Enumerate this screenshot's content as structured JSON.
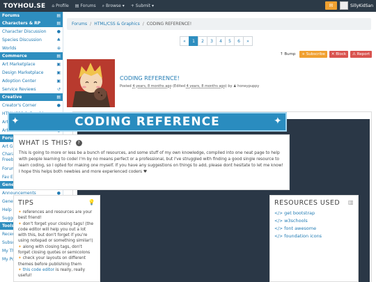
{
  "navbar": {
    "brand": "TOYHOU.SE",
    "links": [
      {
        "icon": "home-icon",
        "glyph": "⌂",
        "label": "Profile"
      },
      {
        "icon": "forums-icon",
        "glyph": "▤",
        "label": "Forums"
      },
      {
        "icon": "search-icon",
        "glyph": "⌕",
        "label": "Browse ▾"
      },
      {
        "icon": "plus-icon",
        "glyph": "+",
        "label": "Submit ▾"
      }
    ],
    "mail_glyph": "✉",
    "username": "SillyKidSan"
  },
  "sidebar": {
    "sections": [
      {
        "title": "Forums",
        "items": []
      },
      {
        "title": "Characters & RP",
        "items": [
          {
            "label": "Character Discussion",
            "glyph": "●"
          },
          {
            "label": "Species Discussion",
            "glyph": "♣"
          },
          {
            "label": "Worlds",
            "glyph": "⊕"
          }
        ]
      },
      {
        "title": "Commerce",
        "items": [
          {
            "label": "Art Marketplace",
            "glyph": "▣"
          },
          {
            "label": "Design Marketplace",
            "glyph": "▣"
          },
          {
            "label": "Adoption Center",
            "glyph": "▣"
          },
          {
            "label": "Service Reviews",
            "glyph": "↺"
          }
        ]
      },
      {
        "title": "Creative",
        "items": [
          {
            "label": "Creator's Corner",
            "glyph": "●"
          },
          {
            "label": "HTML/CSS & Graphics",
            "glyph": "‹›"
          },
          {
            "label": "Art Freebies",
            "glyph": "●"
          },
          {
            "label": "Art Trades",
            "glyph": "●"
          }
        ]
      },
      {
        "title": "Forum Games",
        "items": [
          {
            "label": "Art Games",
            "glyph": "●"
          },
          {
            "label": "Character Games & Freebies",
            "glyph": "●",
            "two": true
          },
          {
            "label": "Forum Games",
            "glyph": "●"
          },
          {
            "label": "Fav Exchange",
            "glyph": "●"
          }
        ]
      },
      {
        "title": "General & Site",
        "items": [
          {
            "label": "Announcements",
            "glyph": "●"
          },
          {
            "label": "General & Off-Topic",
            "glyph": "●"
          },
          {
            "label": "Help & Questions",
            "glyph": "●"
          },
          {
            "label": "Suggestions & Bugs",
            "glyph": "✱"
          }
        ]
      },
      {
        "title": "Tools",
        "items": [
          {
            "label": "Recent Activity",
            "glyph": "●"
          },
          {
            "label": "Subscriptions",
            "glyph": "★"
          },
          {
            "label": "My Threads",
            "glyph": "↰"
          },
          {
            "label": "My Posts",
            "glyph": "●"
          }
        ]
      }
    ]
  },
  "breadcrumb": {
    "items": [
      "Forums",
      "HTML/CSS & Graphics"
    ],
    "current": "CODING REFERENCE!"
  },
  "pagination": {
    "prev": "«",
    "pages": [
      "1",
      "2",
      "3",
      "4",
      "5",
      "6"
    ],
    "active": "1",
    "next": "»"
  },
  "actions": {
    "bump": "↑ Bump",
    "subscribe": "+ Subscribe",
    "block": "✕ Block",
    "report": "⚠ Report"
  },
  "thread": {
    "title": "CODING REFERENCE!",
    "posted_prefix": "Posted",
    "posted_time": "4 years, 8 months ago",
    "edited_prefix": "(Edited",
    "edited_time": "4 years, 8 months ago",
    "edited_suffix": ") by",
    "author": "♟ honeypuppy"
  },
  "post": {
    "banner": "CODING REFERENCE",
    "what_title": "WHAT IS THIS?",
    "what_text": "This is going to more or less be a bunch of resources, and some stuff of my own knowledge, compiled into one neat page to help with people learning to code! I'm by no means perfect or a professional, but I've struggled with finding a good single resource to learn coding, so I opted for making one myself. If you have any suggestions on things to add, please dont hesitate to let me know! I hope this helps both newbies and more experienced coders ♥",
    "tips_title": "TIPS",
    "tips": [
      {
        "text": "references and resources are your best friend!"
      },
      {
        "text": "don't forget your closing tags! (the code editor will help you out a lot with this, but don't forget if you're using notepad or something similar!)"
      },
      {
        "text": "along with closing tags, don't forget closing quotes or semicolons"
      },
      {
        "text": "check your layouts on different themes before publishing them"
      },
      {
        "link": "this code editor",
        "text": " is really, really useful!"
      }
    ],
    "res_title": "RESOURCES USED",
    "resources": [
      "get bootstrap",
      "w3schools",
      "font awesome",
      "foundation icons"
    ]
  }
}
